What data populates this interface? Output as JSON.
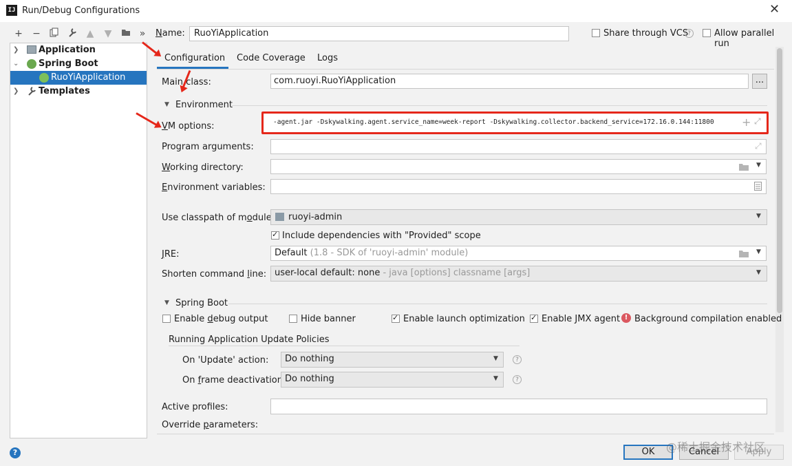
{
  "window": {
    "title": "Run/Debug Configurations",
    "app_icon_text": "IJ"
  },
  "toolbar": {
    "more": "»"
  },
  "tree": {
    "items": [
      {
        "label": "Application",
        "level": 0
      },
      {
        "label": "Spring Boot",
        "level": 0
      },
      {
        "label": "RuoYiApplication",
        "level": 1,
        "selected": true
      },
      {
        "label": "Templates",
        "level": 0
      }
    ]
  },
  "header": {
    "name_label": "Name:",
    "name_value": "RuoYiApplication",
    "share_label": "Share through VCS",
    "parallel_label": "Allow parallel run"
  },
  "tabs": [
    {
      "label": "Configuration",
      "active": true
    },
    {
      "label": "Code Coverage",
      "active": false
    },
    {
      "label": "Logs",
      "active": false
    }
  ],
  "form": {
    "main_class_label": "Main class:",
    "main_class_value": "com.ruoyi.RuoYiApplication",
    "browse_label": "...",
    "environment_section": "Environment",
    "vm_options_label": "VM options:",
    "vm_options_value": "-agent.jar -Dskywalking.agent.service_name=week-report -Dskywalking.collector.backend_service=172.16.0.144:11800",
    "program_args_label": "Program arguments:",
    "working_dir_label": "Working directory:",
    "env_vars_label": "Environment variables:",
    "classpath_label": "Use classpath of module:",
    "classpath_value": "ruoyi-admin",
    "include_deps_label": "Include dependencies with \"Provided\" scope",
    "jre_label": "JRE:",
    "jre_value": "Default",
    "jre_hint": "(1.8 - SDK of 'ruoyi-admin' module)",
    "shorten_label": "Shorten command line:",
    "shorten_value": "user-local default: none",
    "shorten_hint": "- java [options] classname [args]"
  },
  "spring_boot": {
    "section": "Spring Boot",
    "debug_output": "Enable debug output",
    "hide_banner": "Hide banner",
    "launch_opt": "Enable launch optimization",
    "jmx_agent": "Enable JMX agent",
    "bg_compile": "Background compilation enabled",
    "policies_title": "Running Application Update Policies",
    "on_update_label": "On 'Update' action:",
    "on_update_value": "Do nothing",
    "on_frame_label": "On frame deactivation:",
    "on_frame_value": "Do nothing",
    "active_profiles_label": "Active profiles:",
    "override_label": "Override parameters:"
  },
  "footer": {
    "ok": "OK",
    "cancel": "Cancel",
    "apply": "Apply",
    "watermark": "@稀土掘金技术社区"
  },
  "colors": {
    "accent": "#2675bf",
    "highlight": "#e5271a"
  }
}
